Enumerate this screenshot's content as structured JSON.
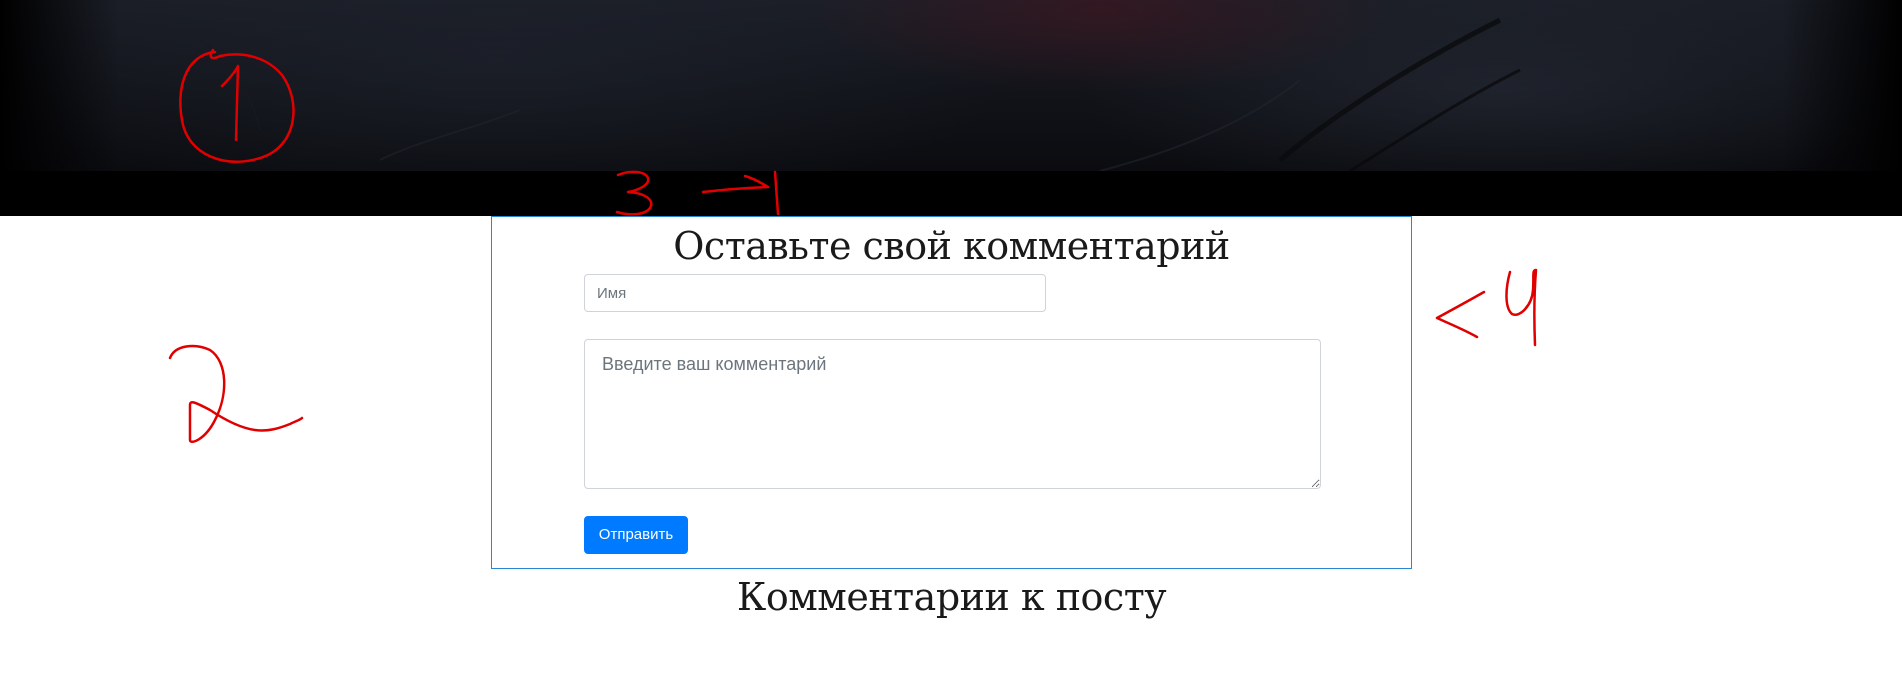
{
  "form": {
    "title": "Оставьте свой комментарий",
    "name_placeholder": "Имя",
    "comment_placeholder": "Введите ваш комментарий",
    "submit_label": "Отправить"
  },
  "comments": {
    "heading": "Комментарии к посту"
  },
  "annotations": {
    "color": "#e00000",
    "marks": [
      "1",
      "2",
      "3",
      "4"
    ]
  },
  "colors": {
    "primary": "#007bff",
    "card_border": "#2a86d3",
    "hero_background": "#000000"
  }
}
